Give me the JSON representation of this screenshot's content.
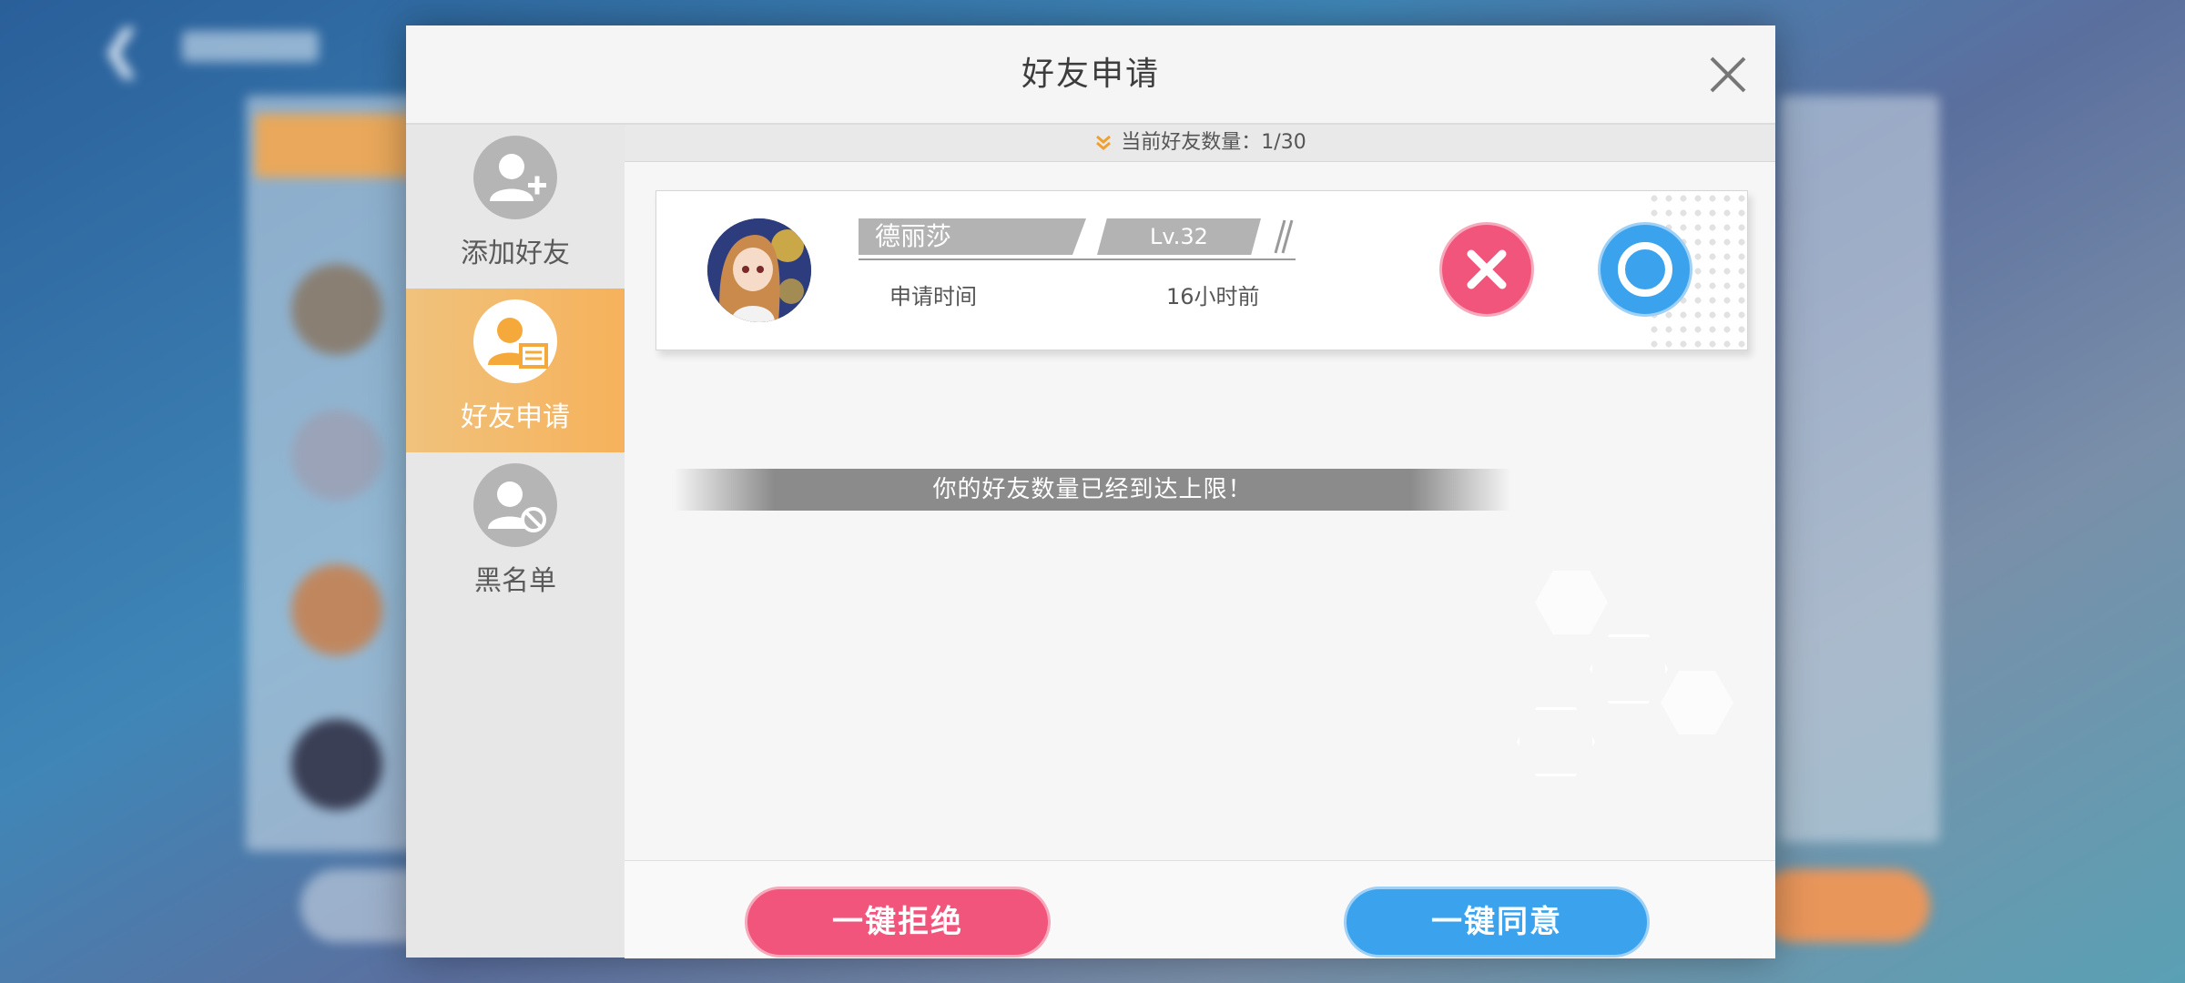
{
  "modal": {
    "title": "好友申请"
  },
  "sidebar": {
    "items": [
      {
        "label": "添加好友",
        "icon": "add-friend-icon",
        "active": false
      },
      {
        "label": "好友申请",
        "icon": "friend-request-icon",
        "active": true
      },
      {
        "label": "黑名单",
        "icon": "blacklist-icon",
        "active": false
      }
    ]
  },
  "friend_count": {
    "text": "当前好友数量：1/30"
  },
  "requests": [
    {
      "name": "德丽莎",
      "level": "Lv.32",
      "time_label": "申请时间",
      "time_value": "16小时前"
    }
  ],
  "notice": {
    "text": "你的好友数量已经到达上限！"
  },
  "footer": {
    "reject_all": "一键拒绝",
    "accept_all": "一键同意"
  },
  "colors": {
    "reject": "#f2557b",
    "accept": "#3ba3ee",
    "active_tab": "#f6b25b"
  }
}
